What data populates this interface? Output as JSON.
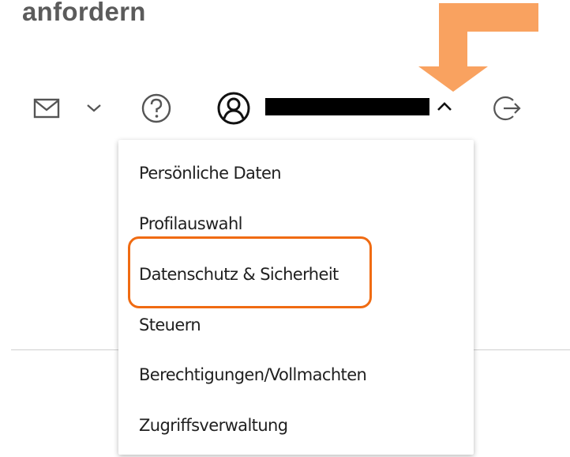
{
  "heading": "anfordern",
  "toolbar": {
    "icons": [
      "mail-icon",
      "chevron-down-icon",
      "help-icon",
      "user-icon",
      "chevron-up-icon",
      "logout-icon"
    ]
  },
  "account_menu": {
    "items": [
      {
        "label": "Persönliche Daten"
      },
      {
        "label": "Profilauswahl"
      },
      {
        "label": "Datenschutz & Sicherheit"
      },
      {
        "label": "Steuern"
      },
      {
        "label": "Berechtigungen/Vollmachten"
      },
      {
        "label": "Zugriffsverwaltung"
      }
    ]
  },
  "colors": {
    "highlight_border": "#f06b12",
    "arrow": "#f9a260",
    "redaction": "#000000",
    "heading": "#5b5b5b"
  }
}
